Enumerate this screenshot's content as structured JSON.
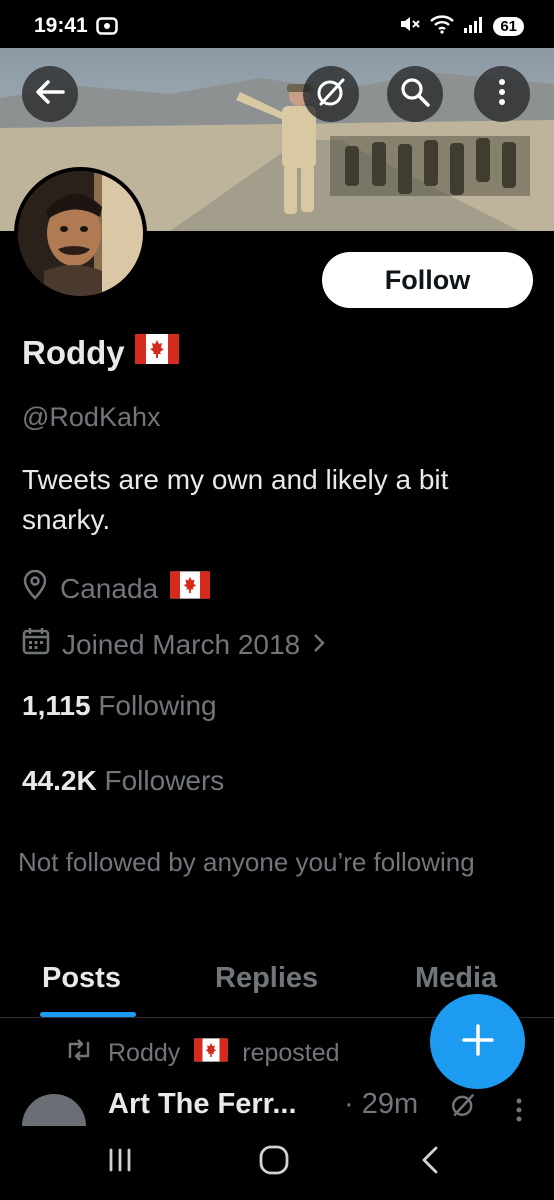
{
  "status_bar": {
    "time": "19:41",
    "battery": "61"
  },
  "banner": {
    "back_icon": "arrow-left-icon",
    "grok_icon": "grok-icon",
    "search_icon": "search-icon",
    "more_icon": "more-vertical-icon"
  },
  "profile": {
    "follow_label": "Follow",
    "display_name": "Roddy",
    "handle": "@RodKahx",
    "bio": "Tweets are my own and likely a bit snarky.",
    "location": "Canada",
    "joined": "Joined March 2018",
    "following_count": "1,115",
    "following_label": "Following",
    "followers_count": "44.2K",
    "followers_label": "Followers",
    "not_followed": "Not followed by anyone you’re following"
  },
  "tabs": [
    {
      "label": "Posts",
      "active": true
    },
    {
      "label": "Replies",
      "active": false
    },
    {
      "label": "Media",
      "active": false
    }
  ],
  "feed": {
    "repost_name": "Roddy",
    "repost_suffix": "reposted",
    "post_author": "Art The Ferr...",
    "post_time": "· 29m"
  },
  "colors": {
    "accent": "#1d9bf0",
    "muted": "#71767b",
    "text": "#e7e9ea",
    "background": "#000000"
  }
}
